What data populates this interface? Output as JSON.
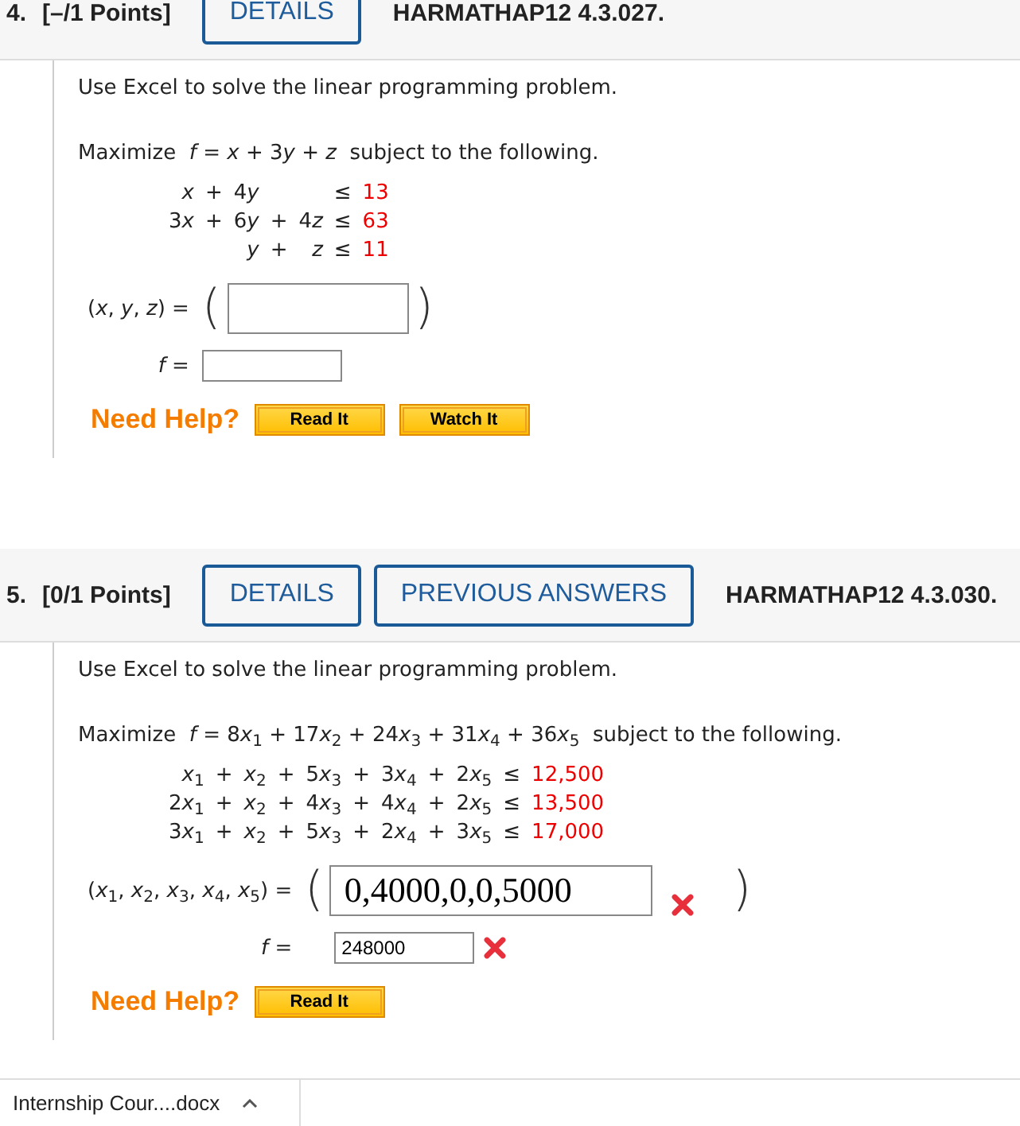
{
  "questions": [
    {
      "number": "4.",
      "points": "[–/1 Points]",
      "buttons": [
        "DETAILS"
      ],
      "code": "HARMATHAP12 4.3.027.",
      "intro": "Use Excel to solve the linear programming problem.",
      "objective": {
        "before": "Maximize",
        "lhs": "f",
        "sign": "=",
        "terms": [
          {
            "kind": "term",
            "var": "x"
          },
          {
            "kind": "op",
            "text": "+"
          },
          {
            "kind": "term",
            "coef": "3",
            "var": "y"
          },
          {
            "kind": "op",
            "text": "+"
          },
          {
            "kind": "term",
            "var": "z"
          }
        ],
        "after": "subject to the following."
      },
      "constraints": [
        {
          "terms": [
            {
              "kind": "term",
              "var": "x"
            },
            {
              "kind": "op",
              "text": "+"
            },
            {
              "kind": "term",
              "coef": "4",
              "var": "y"
            },
            {
              "kind": "blank"
            },
            {
              "kind": "blank"
            }
          ],
          "sign": "≤",
          "rhs": "13"
        },
        {
          "terms": [
            {
              "kind": "term",
              "coef": "3",
              "var": "x"
            },
            {
              "kind": "op",
              "text": "+"
            },
            {
              "kind": "term",
              "coef": "6",
              "var": "y"
            },
            {
              "kind": "op",
              "text": "+"
            },
            {
              "kind": "term",
              "coef": "4",
              "var": "z"
            }
          ],
          "sign": "≤",
          "rhs": "63"
        },
        {
          "terms": [
            {
              "kind": "blank"
            },
            {
              "kind": "blank"
            },
            {
              "kind": "term",
              "var": "y"
            },
            {
              "kind": "op",
              "text": "+"
            },
            {
              "kind": "term",
              "var": "z"
            }
          ],
          "sign": "≤",
          "rhs": "11"
        }
      ],
      "answers": [
        {
          "kind": "tuple",
          "label": {
            "open": "(",
            "vars": [
              {
                "var": "x"
              },
              {
                "var": "y"
              },
              {
                "var": "z"
              }
            ],
            "sep": ",",
            "close": ")",
            "sign": "="
          },
          "brackets": [
            "(",
            ")"
          ],
          "wrong": false
        },
        {
          "kind": "scalar",
          "label": {
            "vars": [
              {
                "var": "f"
              }
            ],
            "sign": "="
          },
          "wrong": false
        }
      ],
      "help_label": "Need Help?",
      "help_buttons": [
        "Read It",
        "Watch It"
      ]
    },
    {
      "number": "5.",
      "points": "[0/1 Points]",
      "buttons": [
        "DETAILS",
        "PREVIOUS ANSWERS"
      ],
      "code": "HARMATHAP12 4.3.030.",
      "intro": "Use Excel to solve the linear programming problem.",
      "objective": {
        "before": "Maximize",
        "lhs": "f",
        "sign": "=",
        "terms": [
          {
            "kind": "term",
            "coef": "8",
            "var": "x",
            "sub": "1"
          },
          {
            "kind": "op",
            "text": "+"
          },
          {
            "kind": "term",
            "coef": "17",
            "var": "x",
            "sub": "2"
          },
          {
            "kind": "op",
            "text": "+"
          },
          {
            "kind": "term",
            "coef": "24",
            "var": "x",
            "sub": "3"
          },
          {
            "kind": "op",
            "text": "+"
          },
          {
            "kind": "term",
            "coef": "31",
            "var": "x",
            "sub": "4"
          },
          {
            "kind": "op",
            "text": "+"
          },
          {
            "kind": "term",
            "coef": "36",
            "var": "x",
            "sub": "5"
          }
        ],
        "after": "subject to the following."
      },
      "constraints": [
        {
          "terms": [
            {
              "kind": "term",
              "var": "x",
              "sub": "1"
            },
            {
              "kind": "op",
              "text": "+"
            },
            {
              "kind": "term",
              "var": "x",
              "sub": "2"
            },
            {
              "kind": "op",
              "text": "+"
            },
            {
              "kind": "term",
              "coef": "5",
              "var": "x",
              "sub": "3"
            },
            {
              "kind": "op",
              "text": "+"
            },
            {
              "kind": "term",
              "coef": "3",
              "var": "x",
              "sub": "4"
            },
            {
              "kind": "op",
              "text": "+"
            },
            {
              "kind": "term",
              "coef": "2",
              "var": "x",
              "sub": "5"
            }
          ],
          "sign": "≤",
          "rhs": "12,500"
        },
        {
          "terms": [
            {
              "kind": "term",
              "coef": "2",
              "var": "x",
              "sub": "1"
            },
            {
              "kind": "op",
              "text": "+"
            },
            {
              "kind": "term",
              "var": "x",
              "sub": "2"
            },
            {
              "kind": "op",
              "text": "+"
            },
            {
              "kind": "term",
              "coef": "4",
              "var": "x",
              "sub": "3"
            },
            {
              "kind": "op",
              "text": "+"
            },
            {
              "kind": "term",
              "coef": "4",
              "var": "x",
              "sub": "4"
            },
            {
              "kind": "op",
              "text": "+"
            },
            {
              "kind": "term",
              "coef": "2",
              "var": "x",
              "sub": "5"
            }
          ],
          "sign": "≤",
          "rhs": "13,500"
        },
        {
          "terms": [
            {
              "kind": "term",
              "coef": "3",
              "var": "x",
              "sub": "1"
            },
            {
              "kind": "op",
              "text": "+"
            },
            {
              "kind": "term",
              "var": "x",
              "sub": "2"
            },
            {
              "kind": "op",
              "text": "+"
            },
            {
              "kind": "term",
              "coef": "5",
              "var": "x",
              "sub": "3"
            },
            {
              "kind": "op",
              "text": "+"
            },
            {
              "kind": "term",
              "coef": "2",
              "var": "x",
              "sub": "4"
            },
            {
              "kind": "op",
              "text": "+"
            },
            {
              "kind": "term",
              "coef": "3",
              "var": "x",
              "sub": "5"
            }
          ],
          "sign": "≤",
          "rhs": "17,000"
        }
      ],
      "answers": [
        {
          "kind": "tuple",
          "label": {
            "open": "(",
            "vars": [
              {
                "var": "x",
                "sub": "1"
              },
              {
                "var": "x",
                "sub": "2"
              },
              {
                "var": "x",
                "sub": "3"
              },
              {
                "var": "x",
                "sub": "4"
              },
              {
                "var": "x",
                "sub": "5"
              }
            ],
            "sep": ",",
            "close": ")",
            "sign": "="
          },
          "brackets": [
            "(",
            ")"
          ],
          "value": "0,4000,0,0,5000",
          "wrong": true
        },
        {
          "kind": "scalar",
          "label": {
            "vars": [
              {
                "var": "f"
              }
            ],
            "sign": "="
          },
          "value": "248000",
          "wrong": true
        }
      ],
      "help_label": "Need Help?",
      "help_buttons": [
        "Read It"
      ]
    }
  ],
  "download_bar": {
    "file": "Internship Cour....docx"
  }
}
